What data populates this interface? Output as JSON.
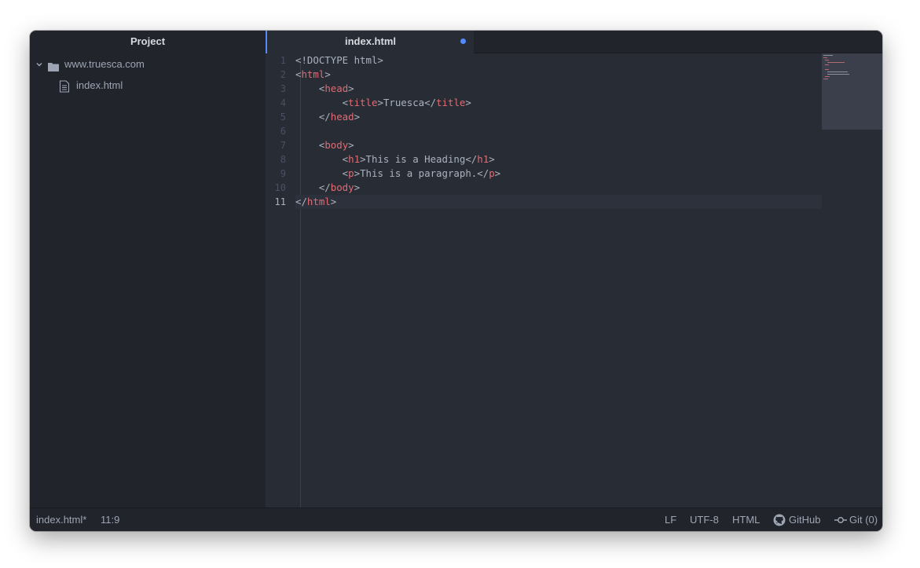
{
  "sidebar": {
    "title": "Project",
    "folder": {
      "name": "www.truesca.com",
      "icon": "folder-icon"
    },
    "file": {
      "name": "index.html",
      "icon": "file-icon"
    }
  },
  "tabs": [
    {
      "label": "index.html",
      "modified": true
    }
  ],
  "editor": {
    "line_numbers": [
      "1",
      "2",
      "3",
      "4",
      "5",
      "6",
      "7",
      "8",
      "9",
      "10",
      "11"
    ],
    "current_line": 11,
    "lines": [
      [
        {
          "t": "<!DOCTYPE html>",
          "c": "text"
        }
      ],
      [
        {
          "t": "<",
          "c": "text"
        },
        {
          "t": "html",
          "c": "tag"
        },
        {
          "t": ">",
          "c": "text"
        }
      ],
      [
        {
          "t": "    <",
          "c": "text"
        },
        {
          "t": "head",
          "c": "tag"
        },
        {
          "t": ">",
          "c": "text"
        }
      ],
      [
        {
          "t": "        <",
          "c": "text"
        },
        {
          "t": "title",
          "c": "tag"
        },
        {
          "t": ">Truesca</",
          "c": "text"
        },
        {
          "t": "title",
          "c": "tag"
        },
        {
          "t": ">",
          "c": "text"
        }
      ],
      [
        {
          "t": "    </",
          "c": "text"
        },
        {
          "t": "head",
          "c": "tag"
        },
        {
          "t": ">",
          "c": "text"
        }
      ],
      [],
      [
        {
          "t": "    <",
          "c": "text"
        },
        {
          "t": "body",
          "c": "tag"
        },
        {
          "t": ">",
          "c": "text"
        }
      ],
      [
        {
          "t": "        <",
          "c": "text"
        },
        {
          "t": "h1",
          "c": "tag"
        },
        {
          "t": ">This is a Heading</",
          "c": "text"
        },
        {
          "t": "h1",
          "c": "tag"
        },
        {
          "t": ">",
          "c": "text"
        }
      ],
      [
        {
          "t": "        <",
          "c": "text"
        },
        {
          "t": "p",
          "c": "tag"
        },
        {
          "t": ">This is a paragraph.</",
          "c": "text"
        },
        {
          "t": "p",
          "c": "tag"
        },
        {
          "t": ">",
          "c": "text"
        }
      ],
      [
        {
          "t": "    </",
          "c": "text"
        },
        {
          "t": "body",
          "c": "tag"
        },
        {
          "t": ">",
          "c": "text"
        }
      ],
      [
        {
          "t": "</",
          "c": "text"
        },
        {
          "t": "html",
          "c": "tag"
        },
        {
          "t": ">",
          "c": "text"
        }
      ]
    ]
  },
  "colors": {
    "tag": "#e06c75",
    "text": "#abb2bf",
    "accent": "#568af2"
  },
  "statusbar": {
    "file": "index.html*",
    "cursor": "11:9",
    "line_ending": "LF",
    "encoding": "UTF-8",
    "grammar": "HTML",
    "github": "GitHub",
    "git": "Git (0)"
  }
}
